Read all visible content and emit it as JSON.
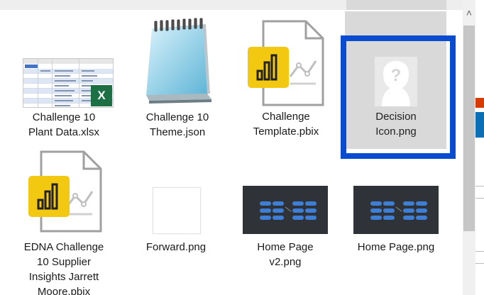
{
  "files": [
    {
      "name": "Challenge 10\nPlant Data.xlsx",
      "icon": "excel-file-icon",
      "selected": false
    },
    {
      "name": "Challenge 10\nTheme.json",
      "icon": "notepad-file-icon",
      "selected": false
    },
    {
      "name": "Challenge\nTemplate.pbix",
      "icon": "powerbi-file-icon",
      "selected": false
    },
    {
      "name": "Decision\nIcon.png",
      "icon": "question-avatar-icon",
      "selected": true
    },
    {
      "name": "EDNA Challenge\n10 Supplier\nInsights Jarrett\nMoore.pbix",
      "icon": "powerbi-file-icon",
      "selected": false
    },
    {
      "name": "Forward.png",
      "icon": "blank-image-icon",
      "selected": false
    },
    {
      "name": "Home Page\nv2.png",
      "icon": "dark-image-thumbnail-icon",
      "selected": false
    },
    {
      "name": "Home Page.png",
      "icon": "dark-image-thumbnail-icon",
      "selected": false
    }
  ],
  "colors": {
    "selection_border": "#0a4cd1",
    "selection_bg": "#d9d9d9",
    "powerbi_badge": "#f2c811",
    "excel_badge": "#1d7044"
  },
  "scrollbar": {
    "up_icon": "chevron-up-icon"
  }
}
